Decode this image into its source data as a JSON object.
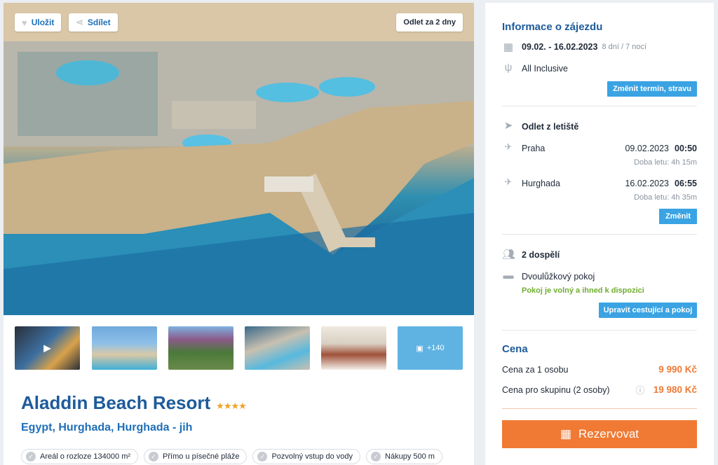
{
  "hero": {
    "save_label": "Uložit",
    "share_label": "Sdílet",
    "departs_label": "Odlet za 2 dny"
  },
  "gallery": {
    "more_label": "+140"
  },
  "hotel": {
    "name": "Aladdin Beach Resort",
    "stars": "★★★★",
    "location": "Egypt, Hurghada, Hurghada - jih",
    "tags": [
      "Areál o rozloze 134000 m²",
      "Přímo u písečné pláže",
      "Pozvolný vstup do vody",
      "Nákupy 500 m"
    ]
  },
  "info": {
    "title": "Informace o zájezdu",
    "dates": "09.02. - 16.02.2023",
    "duration": "8 dní / 7 nocí",
    "board": "All Inclusive",
    "change_date_button": "Změnit termín, stravu",
    "departure_title": "Odlet z letiště",
    "outbound": {
      "city": "Praha",
      "date": "09.02.2023",
      "time": "00:50",
      "flight_time": "Doba letu: 4h 15m"
    },
    "return": {
      "city": "Hurghada",
      "date": "16.02.2023",
      "time": "06:55",
      "flight_time": "Doba letu: 4h 35m"
    },
    "change_button": "Změnit",
    "travelers": "2 dospělí",
    "room": "Dvoulůžkový pokoj",
    "availability": "Pokoj je volný a ihned k dispozici",
    "edit_travelers_button": "Upravit cestující a pokoj"
  },
  "price": {
    "title": "Cena",
    "per_person_label": "Cena za 1 osobu",
    "per_person_value": "9 990 Kč",
    "group_label": "Cena pro skupinu (2 osoby)",
    "group_value": "19 980 Kč",
    "reserve_button": "Rezervovat"
  },
  "colors": {
    "brand_blue": "#1d5b9b",
    "link_blue": "#1e6fb8",
    "button_blue": "#3aa3e3",
    "accent_orange": "#f07a34",
    "available_green": "#6fae2f"
  }
}
